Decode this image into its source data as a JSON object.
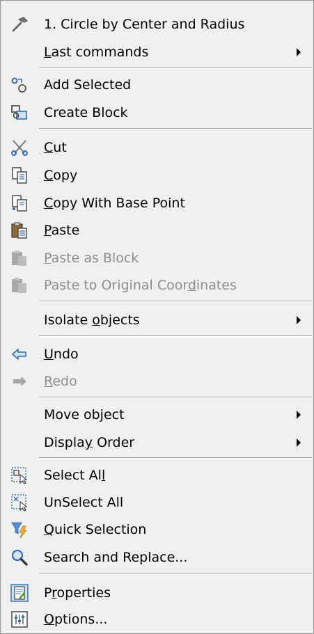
{
  "menu": {
    "items": [
      {
        "id": "circle",
        "icon": "hammer-icon",
        "parts": [
          {
            "t": "1. Circle by Center and Radius"
          }
        ],
        "disabled": false,
        "submenu": false
      },
      {
        "id": "last-commands",
        "icon": "",
        "parts": [
          {
            "t": "L",
            "u": true
          },
          {
            "t": "ast commands"
          }
        ],
        "disabled": false,
        "submenu": true
      },
      {
        "id": "add-selected",
        "icon": "add-selected-icon",
        "parts": [
          {
            "t": "Add Selected"
          }
        ],
        "disabled": false,
        "submenu": false
      },
      {
        "id": "create-block",
        "icon": "create-block-icon",
        "parts": [
          {
            "t": "Create Block"
          }
        ],
        "disabled": false,
        "submenu": false
      },
      {
        "id": "cut",
        "icon": "scissors-icon",
        "parts": [
          {
            "t": "C",
            "u": true
          },
          {
            "t": "ut"
          }
        ],
        "disabled": false,
        "submenu": false
      },
      {
        "id": "copy",
        "icon": "copy-icon",
        "parts": [
          {
            "t": "C",
            "u": true
          },
          {
            "t": "opy"
          }
        ],
        "disabled": false,
        "submenu": false
      },
      {
        "id": "copy-base",
        "icon": "copy-base-point-icon",
        "parts": [
          {
            "t": "C",
            "u": true
          },
          {
            "t": "opy With Base Point"
          }
        ],
        "disabled": false,
        "submenu": false
      },
      {
        "id": "paste",
        "icon": "paste-icon",
        "parts": [
          {
            "t": "P",
            "u": true
          },
          {
            "t": "aste"
          }
        ],
        "disabled": false,
        "submenu": false
      },
      {
        "id": "paste-block",
        "icon": "paste-block-icon",
        "parts": [
          {
            "t": "P",
            "u": true
          },
          {
            "t": "aste as Block"
          }
        ],
        "disabled": true,
        "submenu": false
      },
      {
        "id": "paste-original",
        "icon": "paste-original-icon",
        "parts": [
          {
            "t": "Paste to Original Coor"
          },
          {
            "t": "d",
            "u": true
          },
          {
            "t": "inates"
          }
        ],
        "disabled": true,
        "submenu": false
      },
      {
        "id": "isolate",
        "icon": "",
        "parts": [
          {
            "t": "Isolate "
          },
          {
            "t": "o",
            "u": true
          },
          {
            "t": "bjects"
          }
        ],
        "disabled": false,
        "submenu": true
      },
      {
        "id": "undo",
        "icon": "undo-icon",
        "parts": [
          {
            "t": "U",
            "u": true
          },
          {
            "t": "ndo"
          }
        ],
        "disabled": false,
        "submenu": false
      },
      {
        "id": "redo",
        "icon": "redo-icon",
        "parts": [
          {
            "t": "R",
            "u": true
          },
          {
            "t": "edo"
          }
        ],
        "disabled": true,
        "submenu": false
      },
      {
        "id": "move-object",
        "icon": "",
        "parts": [
          {
            "t": "Move object"
          }
        ],
        "disabled": false,
        "submenu": true
      },
      {
        "id": "display-order",
        "icon": "",
        "parts": [
          {
            "t": "Displa"
          },
          {
            "t": "y",
            "u": true
          },
          {
            "t": " Order"
          }
        ],
        "disabled": false,
        "submenu": true
      },
      {
        "id": "select-all",
        "icon": "select-all-icon",
        "parts": [
          {
            "t": "Select Al"
          },
          {
            "t": "l",
            "u": true
          }
        ],
        "disabled": false,
        "submenu": false
      },
      {
        "id": "unselect-all",
        "icon": "unselect-all-icon",
        "parts": [
          {
            "t": "UnSelect All"
          }
        ],
        "disabled": false,
        "submenu": false
      },
      {
        "id": "quick-selection",
        "icon": "filter-icon",
        "parts": [
          {
            "t": "Q",
            "u": true
          },
          {
            "t": "uick Selection"
          }
        ],
        "disabled": false,
        "submenu": false
      },
      {
        "id": "search-replace",
        "icon": "magnifier-icon",
        "parts": [
          {
            "t": "Search and Replace..."
          }
        ],
        "disabled": false,
        "submenu": false
      },
      {
        "id": "properties",
        "icon": "properties-icon",
        "parts": [
          {
            "t": "P"
          },
          {
            "t": "r",
            "u": true
          },
          {
            "t": "operties"
          }
        ],
        "disabled": false,
        "submenu": false
      },
      {
        "id": "options",
        "icon": "options-icon",
        "parts": [
          {
            "t": "O",
            "u": true
          },
          {
            "t": "ptions..."
          }
        ],
        "disabled": false,
        "submenu": false
      }
    ]
  },
  "colors": {
    "menu_bg": "#f0f0f0",
    "disabled_text": "#8d8d8d",
    "icon_blue": "#2f6fb8",
    "icon_gray": "#a8a8a8"
  }
}
